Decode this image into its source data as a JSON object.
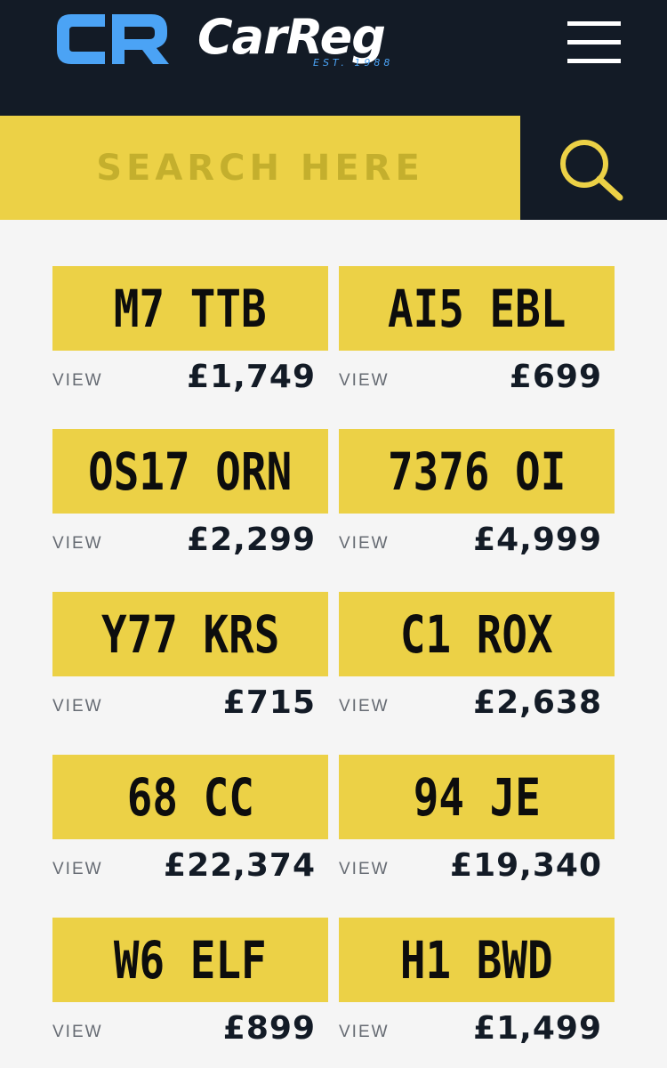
{
  "header": {
    "logo_mark": "CR",
    "logo_text": "CarReg",
    "logo_tagline": "EST. 1988",
    "menu_icon": "hamburger-menu-icon"
  },
  "search": {
    "placeholder": "SEARCH HERE",
    "button_icon": "search-icon"
  },
  "colors": {
    "header_bg": "#131b26",
    "plate_yellow": "#ecd146",
    "logo_blue": "#4ba3f5",
    "page_bg": "#f5f5f5"
  },
  "plates": [
    {
      "registration": "M7 TTB",
      "view_label": "VIEW",
      "price": "£1,749"
    },
    {
      "registration": "AI5 EBL",
      "view_label": "VIEW",
      "price": "£699"
    },
    {
      "registration": "OS17 ORN",
      "view_label": "VIEW",
      "price": "£2,299"
    },
    {
      "registration": "7376 OI",
      "view_label": "VIEW",
      "price": "£4,999"
    },
    {
      "registration": "Y77 KRS",
      "view_label": "VIEW",
      "price": "£715"
    },
    {
      "registration": "C1 ROX",
      "view_label": "VIEW",
      "price": "£2,638"
    },
    {
      "registration": "68 CC",
      "view_label": "VIEW",
      "price": "£22,374"
    },
    {
      "registration": "94 JE",
      "view_label": "VIEW",
      "price": "£19,340"
    },
    {
      "registration": "W6 ELF",
      "view_label": "VIEW",
      "price": "£899"
    },
    {
      "registration": "H1 BWD",
      "view_label": "VIEW",
      "price": "£1,499"
    }
  ]
}
